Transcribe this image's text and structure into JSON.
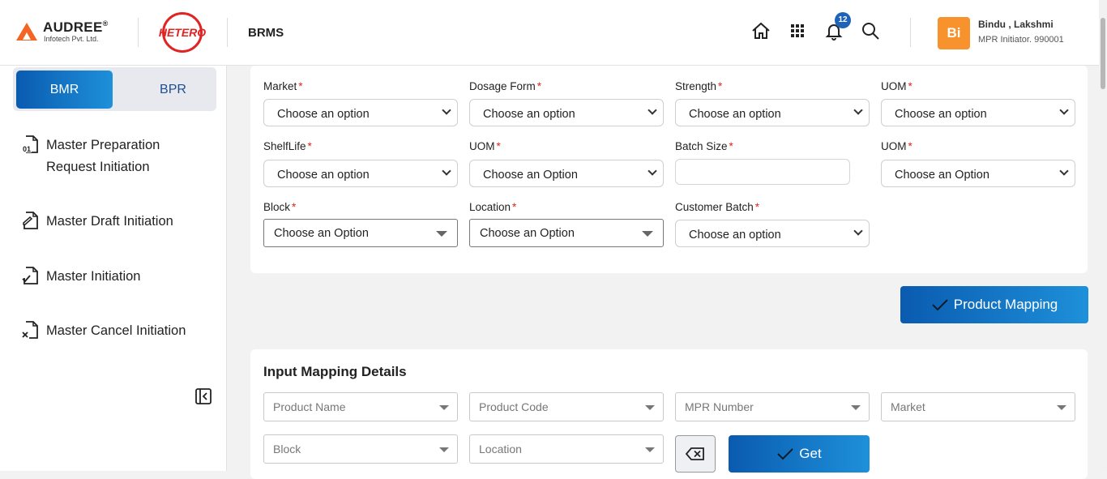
{
  "header": {
    "company_brand": "AUDREE",
    "company_reg": "®",
    "company_sub": "Infotech Pvt. Ltd.",
    "client_logo_text": "HETERO",
    "app_name": "BRMS",
    "notification_count": "12",
    "user": {
      "initials": "Bi",
      "name": "Bindu , Lakshmi",
      "role": "MPR Initiator. 990001"
    }
  },
  "sidebar": {
    "tabs": [
      {
        "label": "BMR",
        "active": true
      },
      {
        "label": "BPR",
        "active": false
      }
    ],
    "items": [
      {
        "label_line1": "Master Preparation",
        "label_line2": "Request Initiation",
        "icon": "document-01-icon"
      },
      {
        "label": "Master Draft Initiation",
        "icon": "document-edit-icon"
      },
      {
        "label": "Master Initiation",
        "icon": "document-check-icon"
      },
      {
        "label": "Master Cancel Initiation",
        "icon": "document-cancel-icon"
      }
    ]
  },
  "form": {
    "required_mark": "*",
    "market": {
      "label": "Market",
      "value": "Choose an option"
    },
    "dosage_form": {
      "label": "Dosage Form",
      "value": "Choose an option"
    },
    "strength": {
      "label": "Strength",
      "value": "Choose an option"
    },
    "uom1": {
      "label": "UOM",
      "value": "Choose an option"
    },
    "shelf_life": {
      "label": "ShelfLife",
      "value": "Choose an option"
    },
    "uom2": {
      "label": "UOM",
      "value": "Choose an Option"
    },
    "batch_size": {
      "label": "Batch Size",
      "value": ""
    },
    "uom3": {
      "label": "UOM",
      "value": "Choose an Option"
    },
    "block": {
      "label": "Block",
      "value": "Choose an Option"
    },
    "location": {
      "label": "Location",
      "value": "Choose an Option"
    },
    "customer_batch": {
      "label": "Customer Batch",
      "value": "Choose an option"
    }
  },
  "actions": {
    "product_mapping": "Product Mapping",
    "get": "Get"
  },
  "input_mapping": {
    "title": "Input Mapping Details",
    "filters": [
      "Product Name",
      "Product Code",
      "MPR Number",
      "Market",
      "Block",
      "Location"
    ]
  },
  "colors": {
    "primary": "#0a5bb0",
    "accent": "#1e90da",
    "required": "#e02424",
    "avatar": "#f7922c"
  }
}
